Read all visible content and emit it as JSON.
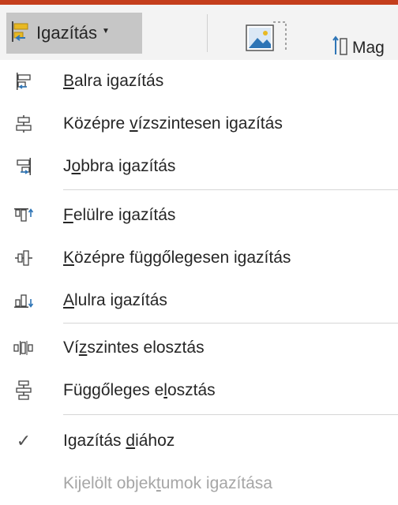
{
  "toolbar": {
    "align_button": {
      "label": "Igazítás",
      "icon": "align-left-icon"
    },
    "image_button": {
      "icon": "picture-icon"
    },
    "mag_button": {
      "label": "Mag",
      "icon": "size-height-icon"
    }
  },
  "menu": {
    "items": [
      {
        "pre": "",
        "ul": "B",
        "post": "alra igazítás",
        "icon": "align-left-icon"
      },
      {
        "pre": "Középre ",
        "ul": "v",
        "post": "ízszintesen igazítás",
        "icon": "align-center-icon"
      },
      {
        "pre": "J",
        "ul": "o",
        "post": "bbra igazítás",
        "icon": "align-right-icon"
      },
      {
        "pre": "",
        "ul": "F",
        "post": "elülre igazítás",
        "icon": "align-top-icon"
      },
      {
        "pre": "",
        "ul": "K",
        "post": "özépre függőlegesen igazítás",
        "icon": "align-middle-icon"
      },
      {
        "pre": "",
        "ul": "A",
        "post": "lulra igazítás",
        "icon": "align-bottom-icon"
      },
      {
        "pre": "Ví",
        "ul": "z",
        "post": "szintes elosztás",
        "icon": "distribute-horizontal-icon"
      },
      {
        "pre": "Függőleges e",
        "ul": "l",
        "post": "osztás",
        "icon": "distribute-vertical-icon"
      },
      {
        "pre": "Igazítás ",
        "ul": "d",
        "post": "iához",
        "icon": "check-icon",
        "checked": true
      },
      {
        "pre": "Kijelölt objek",
        "ul": "t",
        "post": "umok igazítása",
        "icon": "",
        "disabled": true
      }
    ]
  },
  "colors": {
    "accent_bar": "#c43e1c",
    "button_pressed": "#c6c6c6",
    "icon_accent": "#2e75b6",
    "icon_yellow": "#e8b923",
    "disabled_text": "#a6a6a6"
  }
}
